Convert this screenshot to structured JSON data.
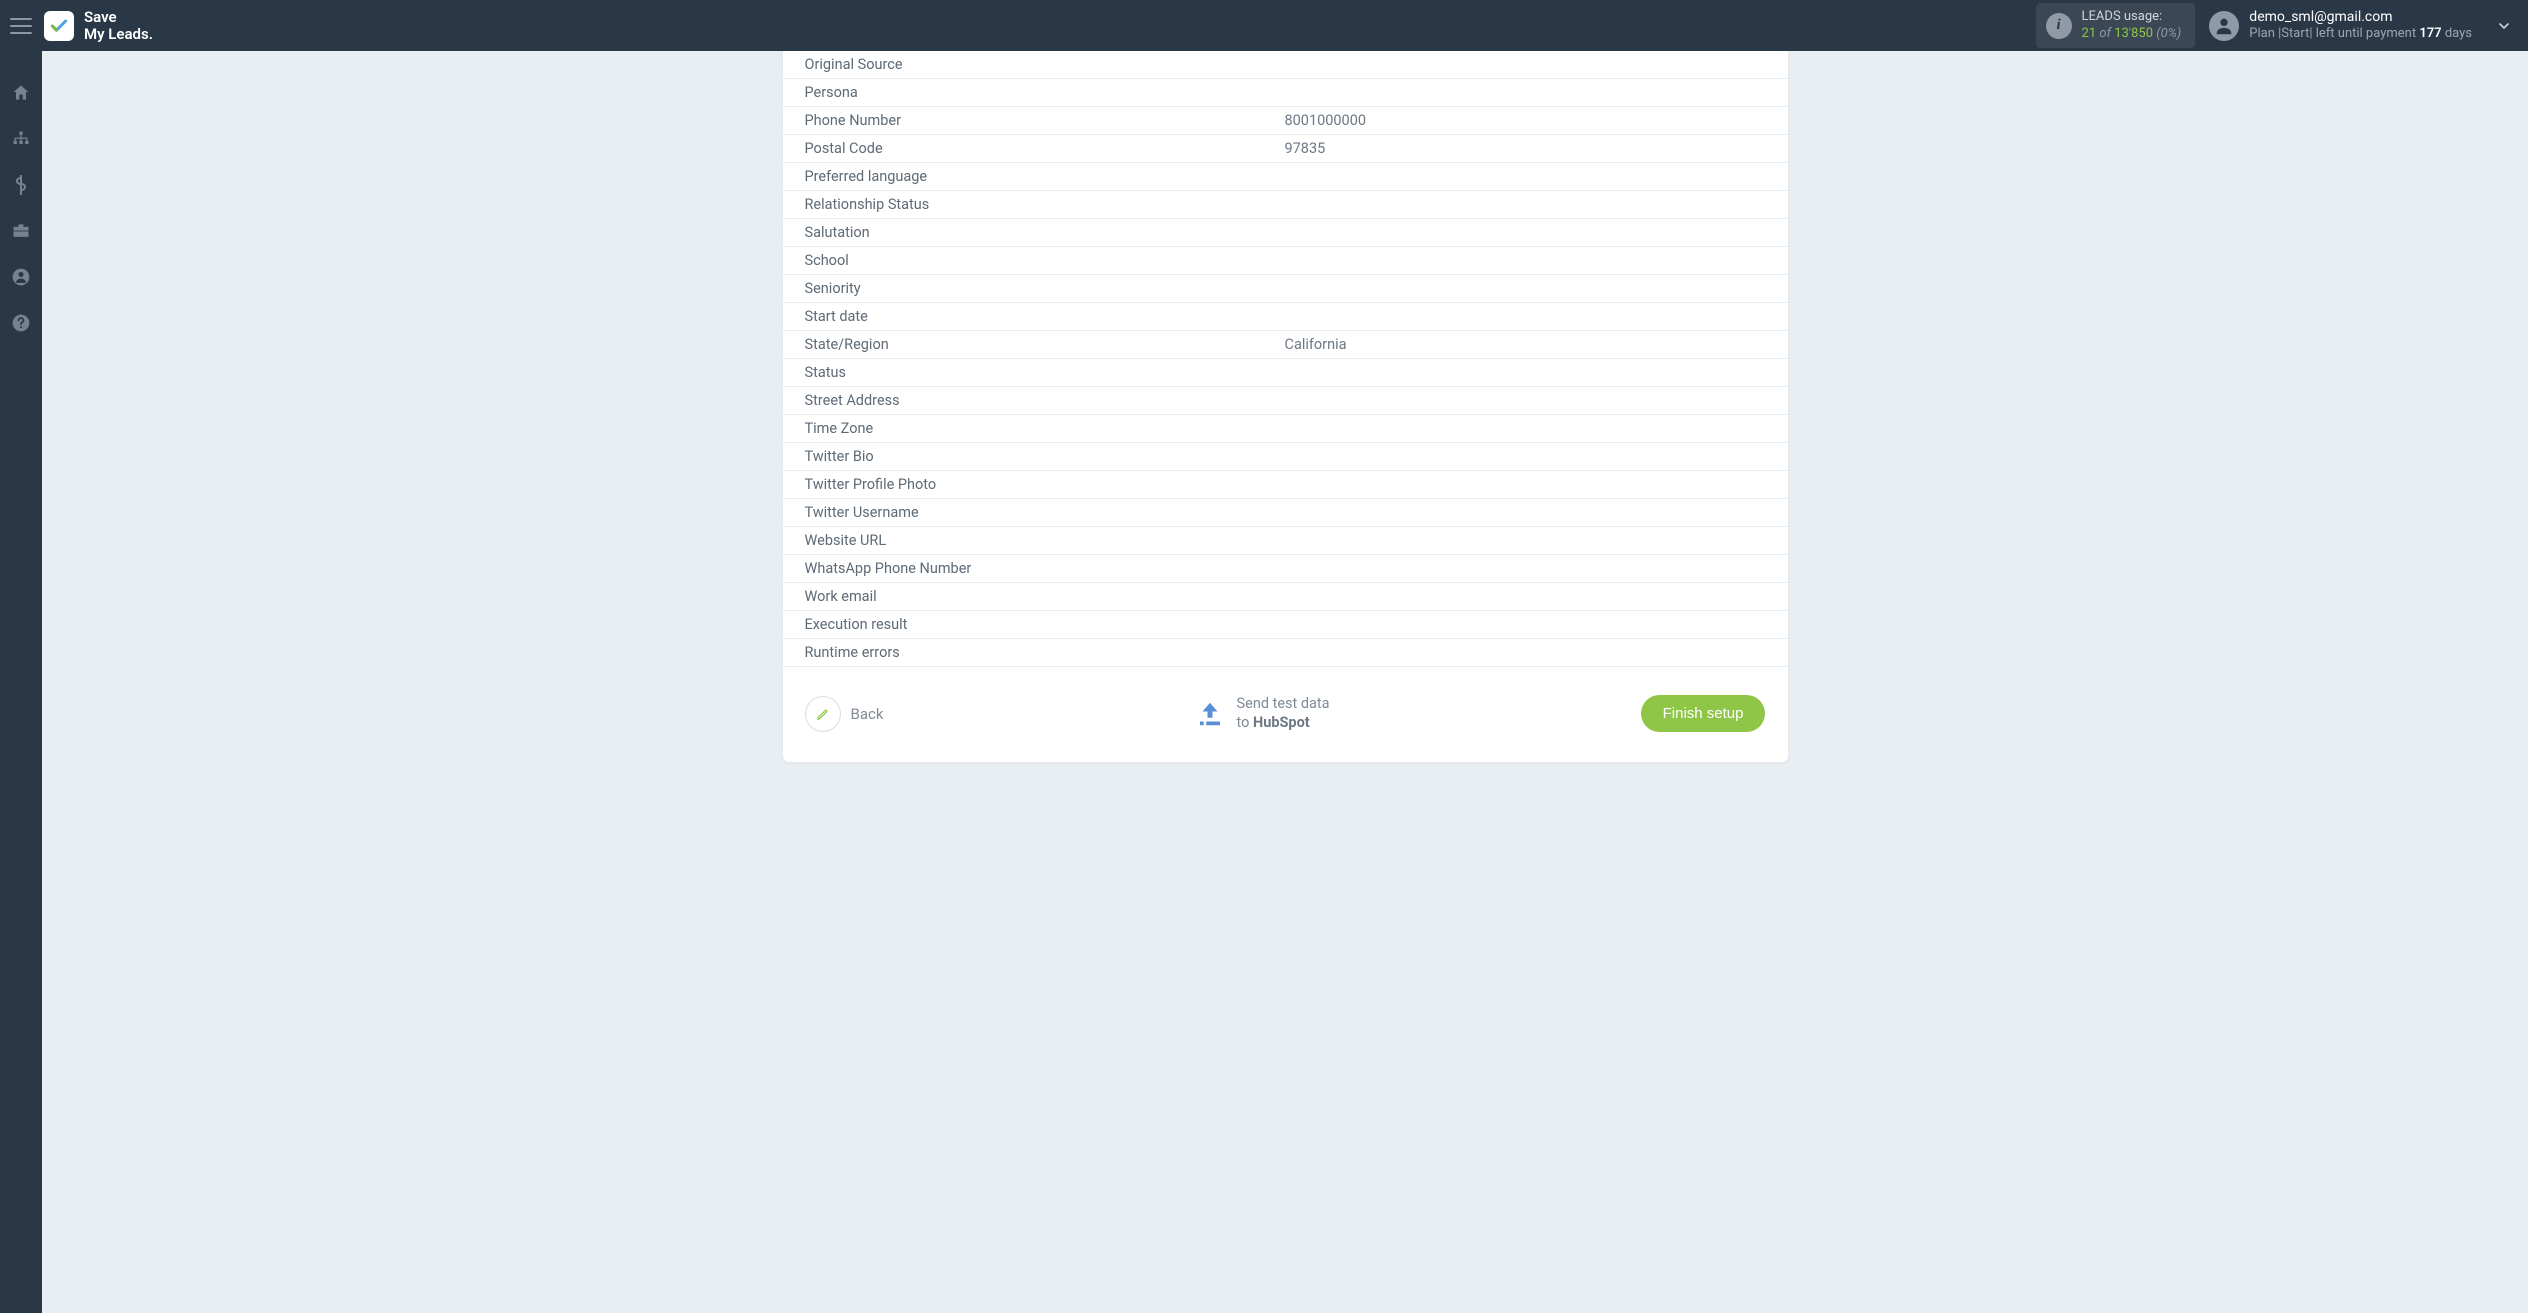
{
  "header": {
    "logo_line1": "Save",
    "logo_line2": "My Leads.",
    "usage": {
      "title": "LEADS usage:",
      "current": "21",
      "of": "of",
      "total": "13'850",
      "percent": "(0%)"
    },
    "user": {
      "email": "demo_sml@gmail.com",
      "plan_prefix": "Plan |Start| left until payment ",
      "plan_days": "177",
      "plan_suffix": " days"
    }
  },
  "fields": [
    {
      "label": "Original Source",
      "value": ""
    },
    {
      "label": "Persona",
      "value": ""
    },
    {
      "label": "Phone Number",
      "value": "8001000000"
    },
    {
      "label": "Postal Code",
      "value": "97835"
    },
    {
      "label": "Preferred language",
      "value": ""
    },
    {
      "label": "Relationship Status",
      "value": ""
    },
    {
      "label": "Salutation",
      "value": ""
    },
    {
      "label": "School",
      "value": ""
    },
    {
      "label": "Seniority",
      "value": ""
    },
    {
      "label": "Start date",
      "value": ""
    },
    {
      "label": "State/Region",
      "value": "California"
    },
    {
      "label": "Status",
      "value": ""
    },
    {
      "label": "Street Address",
      "value": ""
    },
    {
      "label": "Time Zone",
      "value": ""
    },
    {
      "label": "Twitter Bio",
      "value": ""
    },
    {
      "label": "Twitter Profile Photo",
      "value": ""
    },
    {
      "label": "Twitter Username",
      "value": ""
    },
    {
      "label": "Website URL",
      "value": ""
    },
    {
      "label": "WhatsApp Phone Number",
      "value": ""
    },
    {
      "label": "Work email",
      "value": ""
    },
    {
      "label": "Execution result",
      "value": ""
    },
    {
      "label": "Runtime errors",
      "value": ""
    }
  ],
  "footer": {
    "back": "Back",
    "send_line1": "Send test data",
    "send_line2_prefix": "to ",
    "send_line2_bold": "HubSpot",
    "finish": "Finish setup"
  }
}
